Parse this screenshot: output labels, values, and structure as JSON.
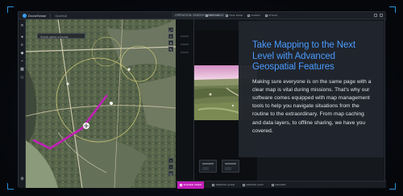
{
  "app": {
    "name": "DroneSense",
    "project": "OpsHub",
    "top_center": "OPERATION: SEARCH & RESCUE 02",
    "top_tools": [
      {
        "label": "SETTINGS"
      },
      {
        "label": "TOOL PAGE"
      },
      {
        "label": "LAYERS"
      },
      {
        "label": "ATTACH"
      }
    ]
  },
  "map": {
    "search_placeholder": "Search places or coords"
  },
  "bottombar": {
    "items": [
      {
        "label": "SHARED VIDEO",
        "active": true
      },
      {
        "label": "REMOTE LAYER",
        "active": false
      },
      {
        "label": "MISSION CHAT",
        "active": false
      },
      {
        "label": "RECORD",
        "active": false
      }
    ]
  },
  "overlay": {
    "title": "Take Mapping to the Next Level with Advanced Geospatial Features",
    "body": "Making sure everyone is on the same page with a clear map is vital during missions. That's why our software comes equipped with map management tools to help you navigate situations from the routine to the extraordinary. From map caching and data layers, to offline sharing, we have you covered."
  },
  "colors": {
    "accent": "#4a9bff",
    "active_tab": "#c21fb8",
    "frame_corner": "#2a8fd8"
  }
}
